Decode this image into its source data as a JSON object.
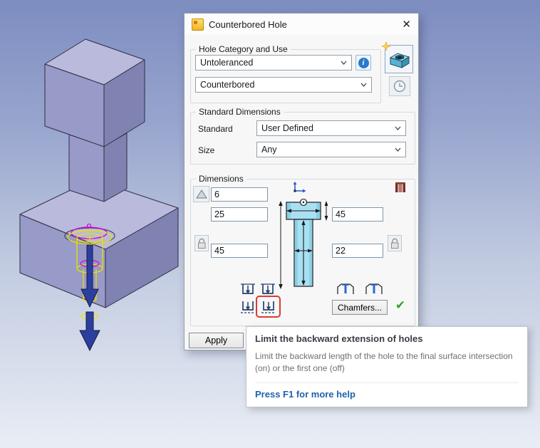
{
  "window": {
    "title": "Counterbored Hole",
    "close_glyph": "✕"
  },
  "category_group": {
    "label": "Hole Category and Use",
    "tolerance_value": "Untoleranced",
    "hole_type_value": "Counterbored",
    "info_glyph": "i"
  },
  "standard_group": {
    "label": "Standard Dimensions",
    "standard_label": "Standard",
    "standard_value": "User Defined",
    "size_label": "Size",
    "size_value": "Any"
  },
  "dimensions_group": {
    "label": "Dimensions",
    "fields": {
      "top_left": "6",
      "mid_left": "25",
      "bottom_left": "45",
      "mid_right": "45",
      "bottom_right": "22"
    },
    "chamfers_label": "Chamfers...",
    "confirm_glyph": "✔"
  },
  "apply_label": "Apply",
  "tooltip": {
    "title": "Limit the backward extension of holes",
    "body": "Limit the backward length of the hole to the final surface intersection (on) or the first one (off)",
    "help_link": "Press F1 for more help"
  },
  "colors": {
    "highlight_red": "#e0392e",
    "check_green": "#2da22d",
    "link_blue": "#1e62ae",
    "preview_yellow": "#ece000",
    "preview_magenta": "#d006d0",
    "arrow_blue": "#2c3f9e",
    "hole_section_fill": "#a8e0f2"
  }
}
